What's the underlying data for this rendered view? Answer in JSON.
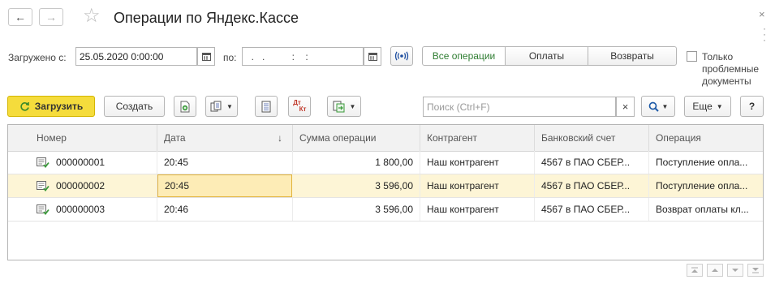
{
  "window": {
    "title": "Операции по Яндекс.Кассе",
    "back_glyph": "←",
    "forward_glyph": "→",
    "star_glyph": "☆",
    "close_glyph": "×"
  },
  "filters": {
    "loaded_from_label": "Загружено с:",
    "date_from": "25.05.2020  0:00:00",
    "to_label": "по:",
    "date_to": "  .   .          :    :  ",
    "segments": [
      {
        "label": "Все операции",
        "active": true
      },
      {
        "label": "Оплаты",
        "active": false
      },
      {
        "label": "Возвраты",
        "active": false
      }
    ],
    "only_problem_label_1": "Только",
    "only_problem_label_2": "проблемные",
    "only_problem_label_3": "документы"
  },
  "toolbar": {
    "load_label": "Загрузить",
    "create_label": "Создать",
    "dtkt_top": "Дт",
    "dtkt_bottom": "Кт",
    "search_placeholder": "Поиск (Ctrl+F)",
    "clear_glyph": "×",
    "more_label": "Еще",
    "help_label": "?"
  },
  "table": {
    "columns": [
      "Номер",
      "Дата",
      "Сумма операции",
      "Контрагент",
      "Банковский счет",
      "Операция"
    ],
    "sort_glyph": "↓",
    "rows": [
      {
        "number": "000000001",
        "date": "20:45",
        "amount": "1 800,00",
        "counterparty": "Наш контрагент",
        "account": "4567 в ПАО СБЕР...",
        "operation": "Поступление опла..."
      },
      {
        "number": "000000002",
        "date": "20:45",
        "amount": "3 596,00",
        "counterparty": "Наш контрагент",
        "account": "4567 в ПАО СБЕР...",
        "operation": "Поступление опла..."
      },
      {
        "number": "000000003",
        "date": "20:46",
        "amount": "3 596,00",
        "counterparty": "Наш контрагент",
        "account": "4567 в ПАО СБЕР...",
        "operation": "Возврат оплаты кл..."
      }
    ],
    "selected_row": 1
  },
  "colors": {
    "load_button": "#f5dc3c",
    "active_segment_text": "#2f7d32",
    "selected_row": "#fdf5d6",
    "doc_icon_green": "#3a9a3a"
  }
}
